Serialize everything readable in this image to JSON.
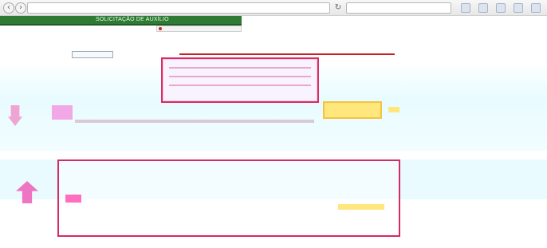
{
  "browser": {
    "url": "",
    "search_placeholder": "",
    "icons": [
      "back-icon",
      "forward-icon",
      "reload-icon",
      "search-icon",
      "bookmark-icon",
      "download-icon",
      "menu-icon"
    ]
  },
  "header": {
    "banner_title": "SOLICITAÇÃO DE AUXÍLIO",
    "subtab_label": "",
    "brand_color": "#2f7a35"
  },
  "intro": {
    "line1": "",
    "line2": "",
    "small_link": ""
  },
  "actions": {
    "confirm_button_label": ""
  },
  "status": {
    "row1": "",
    "row2": ""
  },
  "notice": {
    "line1": "",
    "line2": "",
    "line3": "",
    "line4": "",
    "line5": "",
    "line6": ""
  },
  "footer": {
    "line1": "",
    "line2": "",
    "right_mark": ""
  },
  "colors": {
    "alert": "#d52a62",
    "highlight": "#ffe77d",
    "soft_bg": "#e9fbff"
  }
}
